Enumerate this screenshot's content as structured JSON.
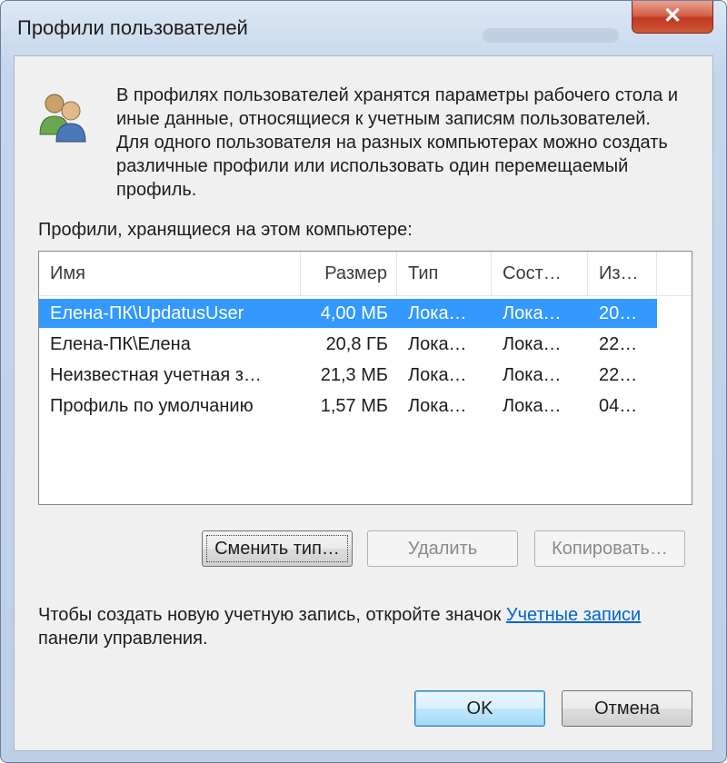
{
  "window": {
    "title": "Профили пользователей",
    "close_symbol": "✕"
  },
  "description": "В профилях пользователей хранятся параметры рабочего стола и иные данные, относящиеся к учетным записям пользователей. Для одного пользователя на разных компьютерах можно создать различные профили или использовать один перемещаемый профиль.",
  "profiles_label": "Профили, хранящиеся на этом компьютере:",
  "list": {
    "columns": [
      "Имя",
      "Размер",
      "Тип",
      "Сост…",
      "Из…"
    ],
    "rows": [
      {
        "name": "Елена-ПК\\UpdatusUser",
        "size": "4,00 МБ",
        "type": "Лока…",
        "state": "Лока…",
        "changed": "20…",
        "selected": true
      },
      {
        "name": "Елена-ПК\\Елена",
        "size": "20,8 ГБ",
        "type": "Лока…",
        "state": "Лока…",
        "changed": "22…",
        "selected": false
      },
      {
        "name": "Неизвестная учетная з…",
        "size": "21,3 МБ",
        "type": "Лока…",
        "state": "Лока…",
        "changed": "22…",
        "selected": false
      },
      {
        "name": "Профиль по умолчанию",
        "size": "1,57 МБ",
        "type": "Лока…",
        "state": "Лока…",
        "changed": "04…",
        "selected": false
      }
    ]
  },
  "buttons": {
    "change_type": "Сменить тип…",
    "delete": "Удалить",
    "copy": "Копировать…",
    "ok": "OK",
    "cancel": "Отмена"
  },
  "info": {
    "prefix": "Чтобы создать новую учетную запись, откройте значок ",
    "link": "Учетные записи",
    "suffix": " панели управления."
  },
  "colors": {
    "selection": "#3399ff",
    "link": "#0066cc"
  }
}
